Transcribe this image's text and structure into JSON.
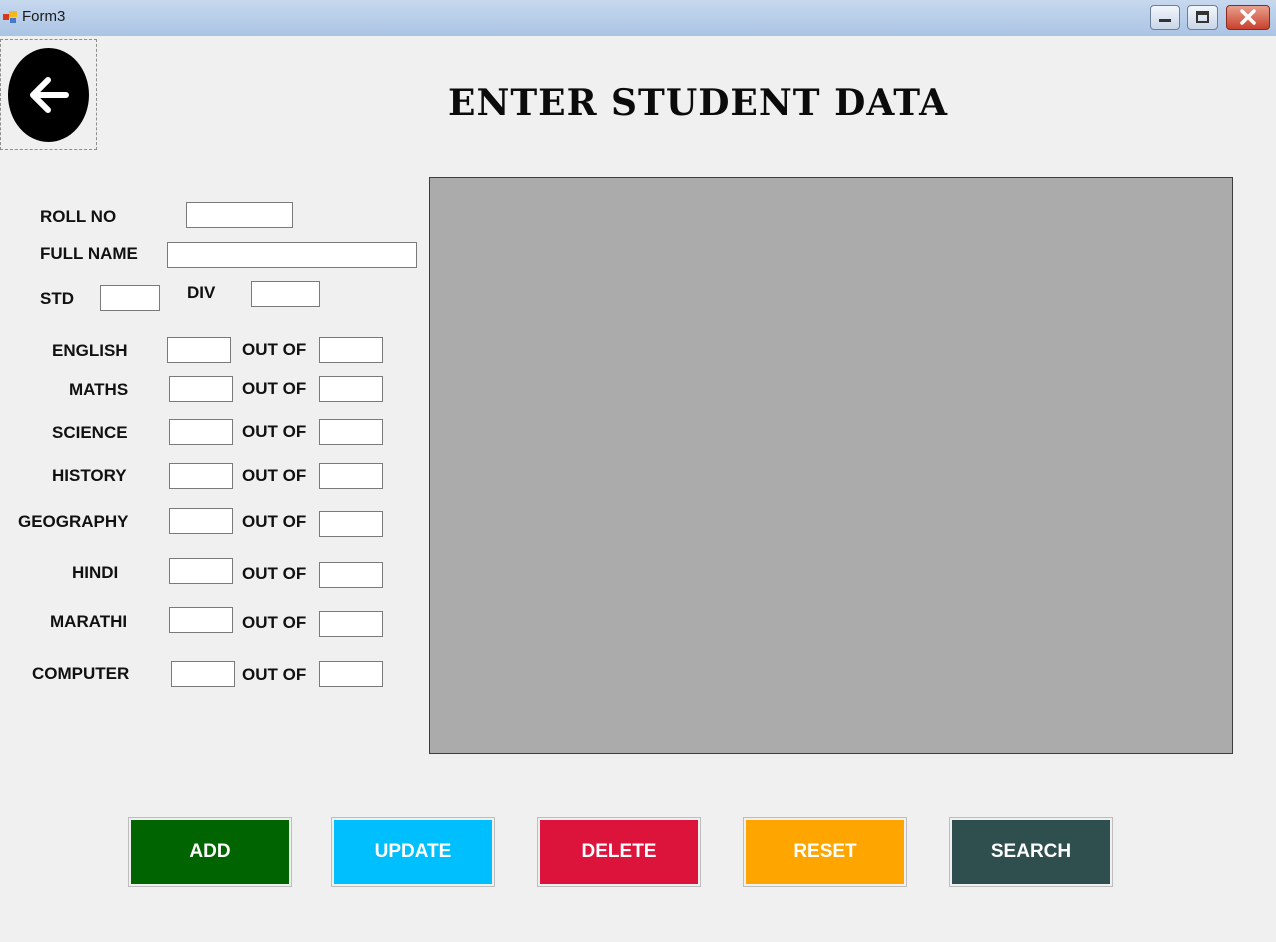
{
  "window": {
    "title": "Form3"
  },
  "heading": "ENTER STUDENT DATA",
  "fields": {
    "roll_no": "ROLL NO",
    "full_name": "FULL NAME",
    "std": "STD",
    "div": "DIV",
    "out_of": "OUT OF"
  },
  "subjects": [
    "ENGLISH",
    "MATHS",
    "SCIENCE",
    "HISTORY",
    "GEOGRAPHY",
    "HINDI",
    "MARATHI",
    "COMPUTER"
  ],
  "buttons": {
    "add": "ADD",
    "update": "UPDATE",
    "delete": "DELETE",
    "reset": "RESET",
    "search": "SEARCH"
  },
  "colors": {
    "add": "#006400",
    "update": "#00bfff",
    "delete": "#dc143c",
    "reset": "#ffa500",
    "search": "#2f4f4f",
    "grid": "#ababab"
  },
  "icons": {
    "back": "arrow-left-icon"
  }
}
